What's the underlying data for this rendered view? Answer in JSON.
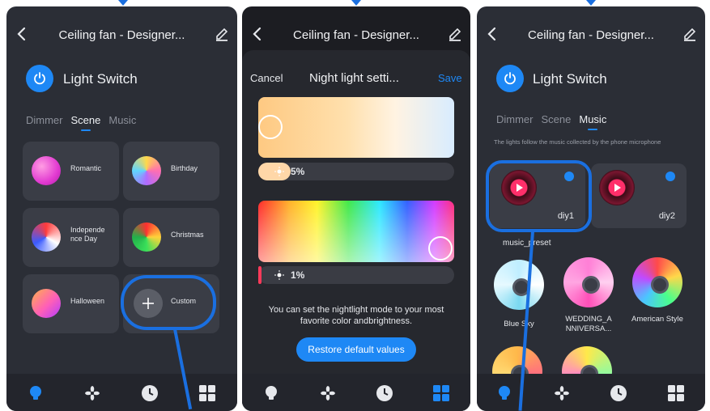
{
  "colors": {
    "accent": "#1e88f5",
    "annotation": "#1a6fe0",
    "background": "#2b2e36"
  },
  "panel1": {
    "title": "Ceiling fan - Designer...",
    "back_icon": "chevron-left-icon",
    "edit_icon": "pencil-icon",
    "power_icon": "power-icon",
    "switch_label": "Light Switch",
    "tabs": [
      "Dimmer",
      "Scene",
      "Music"
    ],
    "active_tab": "Scene",
    "scenes": [
      {
        "label": "Romantic"
      },
      {
        "label": "Birthday"
      },
      {
        "label": "Independe nce Day"
      },
      {
        "label": "Christmas"
      },
      {
        "label": "Halloween"
      },
      {
        "label": "Custom"
      }
    ],
    "nav": [
      "bulb-icon",
      "fan-icon",
      "clock-icon",
      "grid-icon"
    ]
  },
  "panel2": {
    "title": "Ceiling fan - Designer...",
    "cancel": "Cancel",
    "sheet_title": "Night light setti...",
    "save": "Save",
    "white_brightness": "5%",
    "color_brightness": "1%",
    "description": "You can set the nightlight mode to your most favorite color andbrightness.",
    "restore": "Restore default values"
  },
  "panel3": {
    "title": "Ceiling fan - Designer...",
    "switch_label": "Light Switch",
    "tabs": [
      "Dimmer",
      "Scene",
      "Music"
    ],
    "active_tab": "Music",
    "hint": "The lights follow the music collected by the phone microphone",
    "diy": [
      "diy1",
      "diy2"
    ],
    "preset_label": "music_preset",
    "presets": [
      "Blue Sky",
      "WEDDING_A NNIVERSA...",
      "American Style"
    ]
  }
}
